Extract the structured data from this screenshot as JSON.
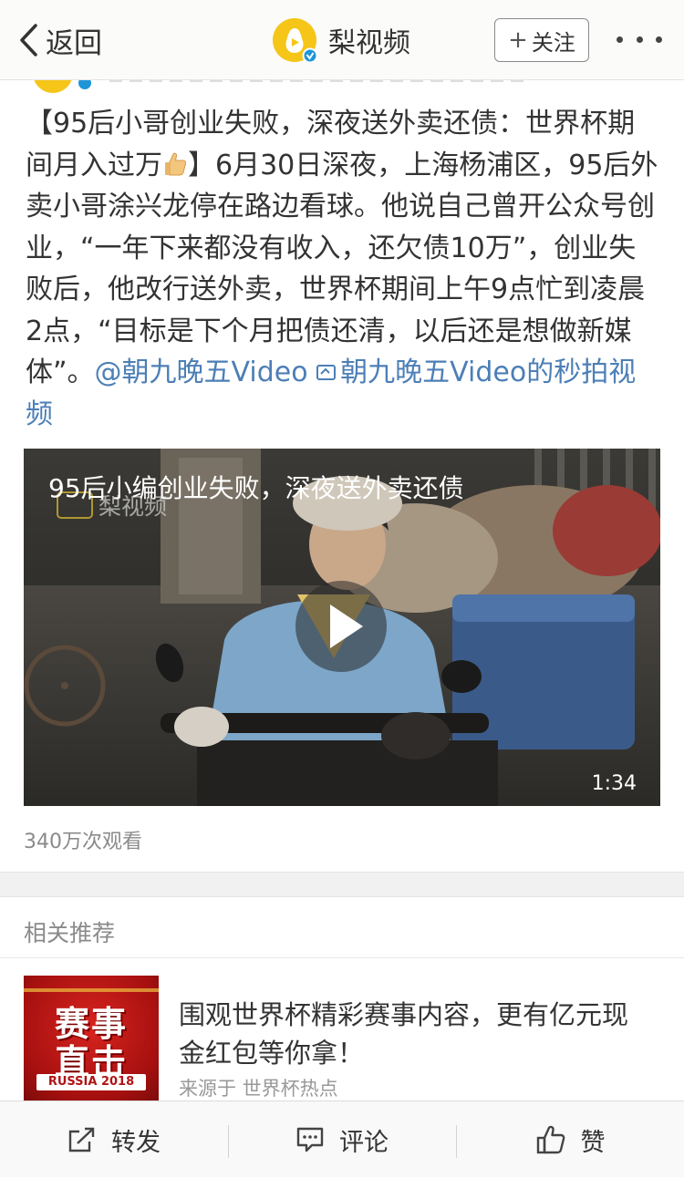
{
  "nav": {
    "back_label": "返回",
    "brand_name": "梨视频",
    "follow_label": "关注",
    "follow_icon": "plus-icon",
    "more_icon": "more-dots-icon"
  },
  "post": {
    "headline": "【95后小哥创业失败，深夜送外卖还债：世界杯期间月入过万",
    "emoji": "thumbs-up-icon",
    "body": "】6月30日深夜，上海杨浦区，95后外卖小哥涂兴龙停在路边看球。他说自己曾开公众号创业，“一年下来都没有收入，还欠债10万”，创业失败后，他改行送外卖，世界杯期间上午9点忙到凌晨2点，“目标是下个月把债还清，以后还是想做新媒体”。",
    "mention": "@朝九晚五Video",
    "link_icon": "video-link-icon",
    "video_link": "朝九晚五Video的秒拍视频"
  },
  "video": {
    "title": "95后小编创业失败，深夜送外卖还债",
    "watermark": "梨视频",
    "duration": "1:34",
    "views": "340万次观看"
  },
  "related": {
    "title": "相关推荐",
    "item": {
      "image_line1": "赛事",
      "image_line2": "直击",
      "image_badge": "RUSSIA 2018",
      "headline": "围观世界杯精彩赛事内容，更有亿元现金红包等你拿！",
      "source": "来源于 世界杯热点"
    }
  },
  "toolbar": {
    "repost_label": "转发",
    "comment_label": "评论",
    "like_label": "赞"
  },
  "colors": {
    "link": "#4c7fb6",
    "brand_yellow": "#f5c518",
    "verified_blue": "#1d95d8"
  }
}
